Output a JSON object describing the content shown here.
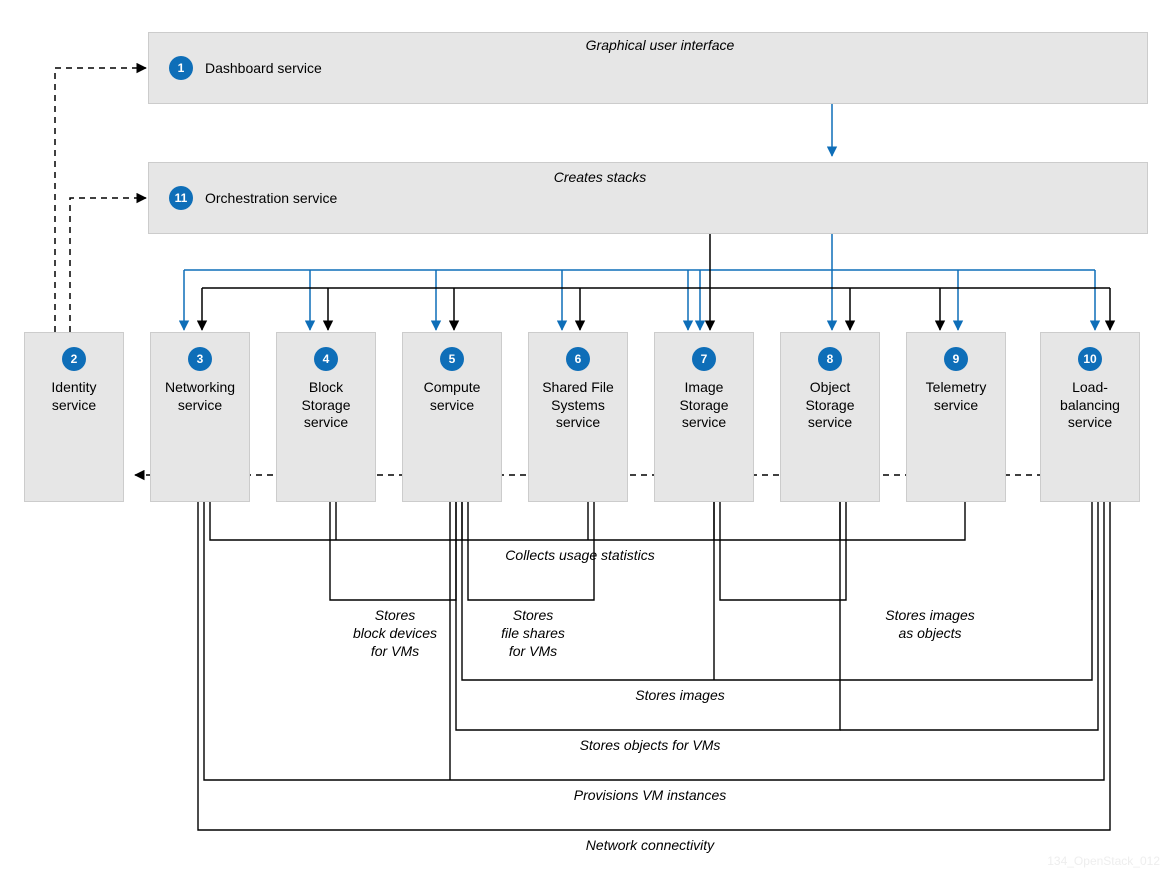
{
  "colors": {
    "blue": "#0e6eb8",
    "black": "#000000",
    "boxFill": "#e6e6e6"
  },
  "topBoxes": {
    "dashboard": {
      "num": "1",
      "label": "Dashboard service",
      "caption": "Graphical user interface"
    },
    "orchestration": {
      "num": "11",
      "label": "Orchestration service",
      "caption": "Creates stacks"
    }
  },
  "services": {
    "identity": {
      "num": "2",
      "label": "Identity service"
    },
    "networking": {
      "num": "3",
      "label": "Networking service"
    },
    "block": {
      "num": "4",
      "label": "Block Storage service"
    },
    "compute": {
      "num": "5",
      "label": "Compute service"
    },
    "sfs": {
      "num": "6",
      "label": "Shared File Systems service"
    },
    "image": {
      "num": "7",
      "label": "Image Storage service"
    },
    "object": {
      "num": "8",
      "label": "Object Storage service"
    },
    "telemetry": {
      "num": "9",
      "label": "Telemetry service"
    },
    "lb": {
      "num": "10",
      "label": "Load-balancing service"
    }
  },
  "relations": {
    "collects": "Collects usage statistics",
    "blockVMs": "Stores\nblock devices\nfor VMs",
    "fileVMs": "Stores\nfile shares\nfor VMs",
    "imgObjects": "Stores images\nas objects",
    "storesImages": "Stores images",
    "objectsVMs": "Stores objects for VMs",
    "provisions": "Provisions VM instances",
    "netconn": "Network connectivity"
  },
  "watermark": "134_OpenStack_012"
}
